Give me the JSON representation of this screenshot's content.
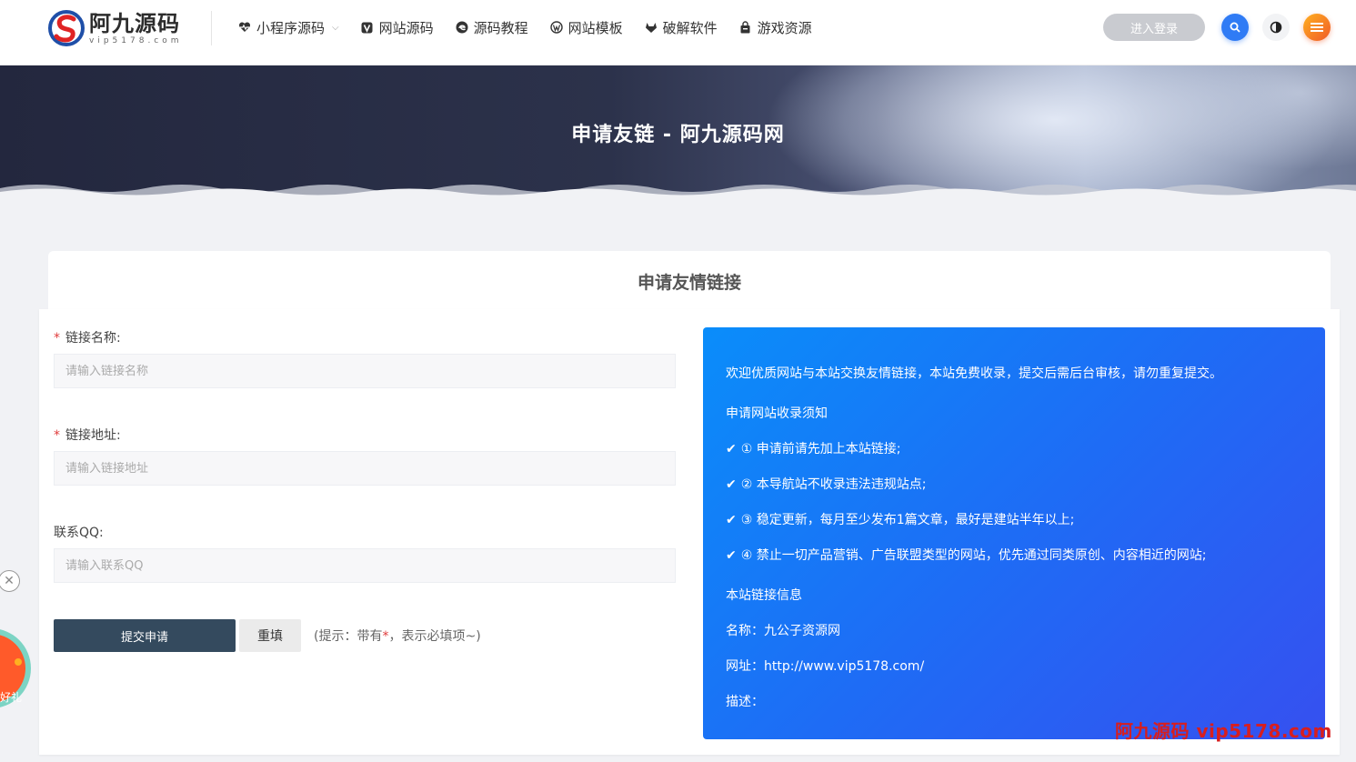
{
  "header": {
    "logo_title": "阿九源码",
    "logo_sub": "vip5178.com",
    "nav": [
      {
        "label": "小程序源码",
        "icon": "heartbeat-icon",
        "has_dropdown": true
      },
      {
        "label": "网站源码",
        "icon": "v-shield-icon",
        "has_dropdown": false
      },
      {
        "label": "源码教程",
        "icon": "edge-icon",
        "has_dropdown": false
      },
      {
        "label": "网站模板",
        "icon": "wordpress-icon",
        "has_dropdown": false
      },
      {
        "label": "破解软件",
        "icon": "gitlab-icon",
        "has_dropdown": false
      },
      {
        "label": "游戏资源",
        "icon": "bag-icon",
        "has_dropdown": false
      }
    ],
    "login_label": "进入登录"
  },
  "banner": {
    "title": "申请友链 - 阿九源码网"
  },
  "card": {
    "title": "申请友情链接"
  },
  "form": {
    "name_label": "链接名称:",
    "name_placeholder": "请输入链接名称",
    "url_label": "链接地址:",
    "url_placeholder": "请输入链接地址",
    "qq_label": "联系QQ:",
    "qq_placeholder": "请输入联系QQ",
    "required_mark": "*",
    "submit_label": "提交申请",
    "reset_label": "重填",
    "hint_prefix": "(提示：带有",
    "hint_suffix": "，表示必填项~)"
  },
  "info": {
    "intro": "欢迎优质网站与本站交换友情链接，本站免费收录，提交后需后台审核，请勿重复提交。",
    "rules_title": "申请网站收录须知",
    "rules": [
      "① 申请前请先加上本站链接;",
      "② 本导航站不收录违法违规站点;",
      "③ 稳定更新，每月至少发布1篇文章，最好是建站半年以上;",
      "④ 禁止一切产品营销、广告联盟类型的网站，优先通过同类原创、内容相近的网站;"
    ],
    "check_mark": "✔",
    "site_info_title": "本站链接信息",
    "site_name": "名称：九公子资源网",
    "site_url": "网址：http://www.vip5178.com/",
    "site_desc": "描述："
  },
  "widgets": {
    "close_glyph": "✕",
    "promo_text": "好礼"
  },
  "watermark": "阿九源码 vip5178.com",
  "colors": {
    "accent": "#2f7bf5",
    "submit": "#344a5e",
    "required": "#e03c3c",
    "info_gradient_start": "#0a8dfa",
    "info_gradient_end": "#3650f0"
  }
}
